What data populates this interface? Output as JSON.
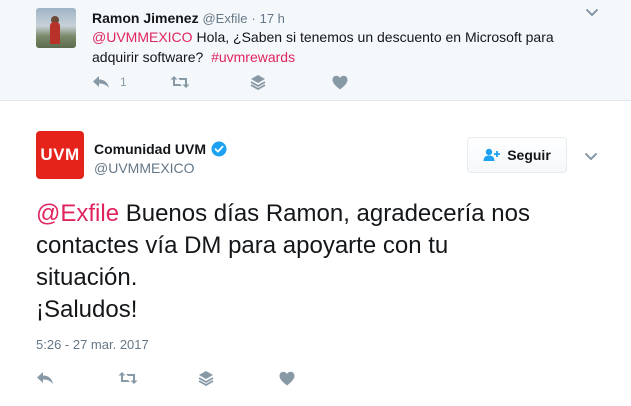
{
  "reply_tweet": {
    "author_name": "Ramon Jimenez",
    "author_handle": "@Exfile",
    "separator": "·",
    "time": "17 h",
    "text_mention": "@UVMMEXICO",
    "text_line1": " Hola, ¿Saben si tenemos un descuento en Microsoft para",
    "text_line2": "adquirir software?",
    "hashtag": "#uvmrewards",
    "reply_count": "1"
  },
  "main_tweet": {
    "logo_text": "UVM",
    "author_name": "Comunidad UVM",
    "author_handle": "@UVMMEXICO",
    "follow_label": "Seguir",
    "text_mention": "@Exfile",
    "text_line1": " Buenos días Ramon, agradecería nos",
    "text_line2": "contactes vía DM para apoyarte con tu",
    "text_line3": "situación.",
    "text_line4": "¡Saludos!",
    "timestamp": "5:26 - 27 mar. 2017"
  },
  "colors": {
    "mention": "#e0245e",
    "verified": "#1da1f2",
    "brand_uvm": "#e5231b",
    "icon": "#8899a6"
  },
  "icons": [
    "reply-icon",
    "retweet-icon",
    "stack-icon",
    "like-icon",
    "chevron-down-icon",
    "follow-user-icon",
    "verified-badge-icon"
  ]
}
